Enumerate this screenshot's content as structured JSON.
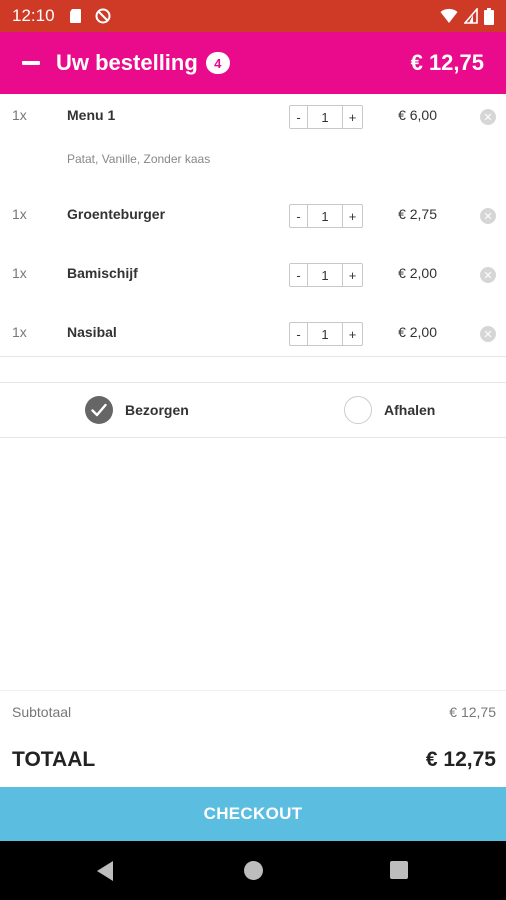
{
  "status_bar": {
    "time": "12:10",
    "icons": [
      "sd-card-icon",
      "no-disturb-icon",
      "wifi-icon",
      "signal-icon",
      "battery-icon"
    ]
  },
  "header": {
    "title": "Uw bestelling",
    "count_badge": "4",
    "total": "€ 12,75",
    "collapse_icon": "minus-icon",
    "color": "#ea0b8c"
  },
  "items": [
    {
      "qty": "1x",
      "name": "Menu 1",
      "stepper_minus": "-",
      "stepper_value": "1",
      "stepper_plus": "+",
      "price": "€ 6,00",
      "extras": "Patat, Vanille, Zonder kaas"
    },
    {
      "qty": "1x",
      "name": "Groenteburger",
      "stepper_minus": "-",
      "stepper_value": "1",
      "stepper_plus": "+",
      "price": "€ 2,75"
    },
    {
      "qty": "1x",
      "name": "Bamischijf",
      "stepper_minus": "-",
      "stepper_value": "1",
      "stepper_plus": "+",
      "price": "€ 2,00"
    },
    {
      "qty": "1x",
      "name": "Nasibal",
      "stepper_minus": "-",
      "stepper_value": "1",
      "stepper_plus": "+",
      "price": "€ 2,00"
    }
  ],
  "delivery": {
    "options": [
      {
        "label": "Bezorgen",
        "selected": true
      },
      {
        "label": "Afhalen",
        "selected": false
      }
    ]
  },
  "summary": {
    "subtotal_label": "Subtotaal",
    "subtotal_value": "€ 12,75",
    "total_label": "TOTAAL",
    "total_value": "€ 12,75"
  },
  "checkout": {
    "label": "CHECKOUT",
    "color": "#5bbde0"
  },
  "nav": {
    "icons": [
      "back-icon",
      "home-icon",
      "recents-icon"
    ]
  }
}
